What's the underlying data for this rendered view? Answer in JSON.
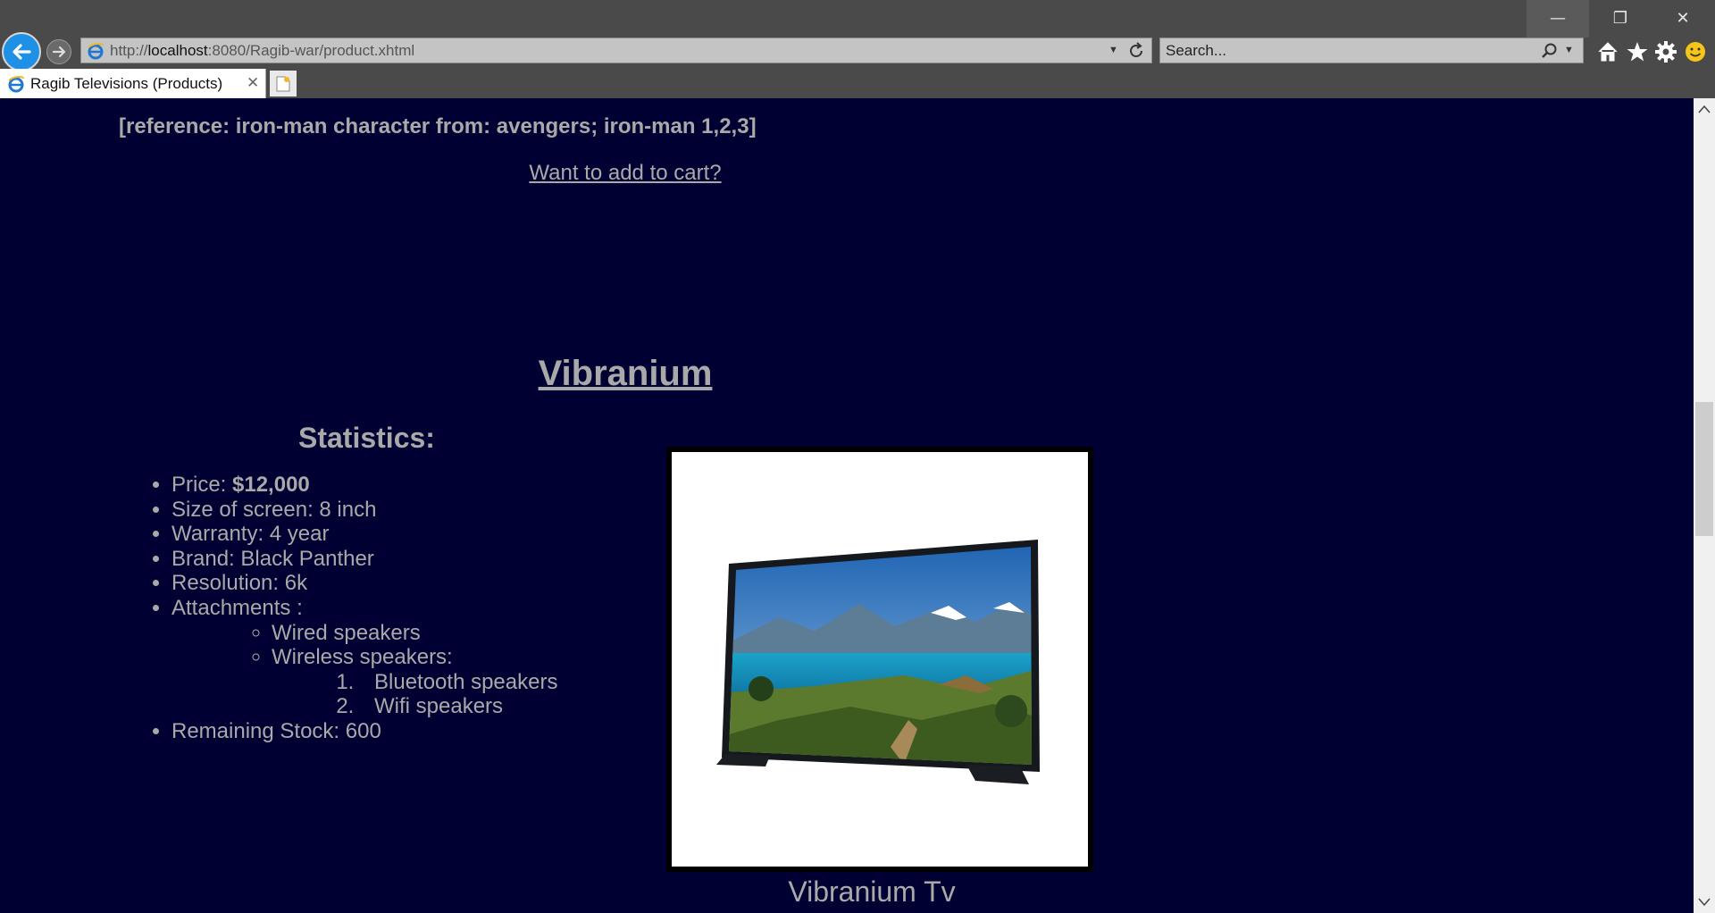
{
  "browser": {
    "address_protocol": "http://",
    "address_host": "localhost",
    "address_rest": ":8080/Ragib-war/product.xhtml",
    "search_placeholder": "Search...",
    "tab_title": "Ragib Televisions (Products)",
    "window_buttons": {
      "minimize": "—",
      "restore": "❐",
      "close": "✕"
    },
    "tab_close": "✕"
  },
  "page": {
    "reference_text": "[reference: iron-man character from: avengers; iron-man 1,2,3]",
    "cart_link": "Want to add to cart?",
    "product": {
      "title": "Vibranium",
      "statistics_heading": "Statistics:",
      "price_label": "Price: ",
      "price_value": "$12,000",
      "screen_size": "Size of screen: 8 inch",
      "warranty": "Warranty: 4 year",
      "brand": "Brand: Black Panther",
      "resolution": "Resolution: 6k",
      "attachments_label": "Attachments :",
      "wired": "Wired speakers",
      "wireless": "Wireless speakers:",
      "bluetooth": "Bluetooth speakers",
      "wifi": "Wifi speakers",
      "remaining_stock": "Remaining Stock: 600",
      "image_caption": "Vibranium Tv"
    }
  },
  "colors": {
    "page_bg": "#000033",
    "page_text": "#a9a9a9",
    "chrome_bg": "#4a4a4a",
    "back_button": "#1e90e6"
  },
  "icons": [
    "ie-logo-icon",
    "back-arrow-icon",
    "forward-arrow-icon",
    "refresh-icon",
    "search-icon",
    "home-icon",
    "star-icon",
    "gear-icon",
    "smiley-icon",
    "new-tab-icon",
    "scroll-up-icon",
    "scroll-down-icon"
  ]
}
